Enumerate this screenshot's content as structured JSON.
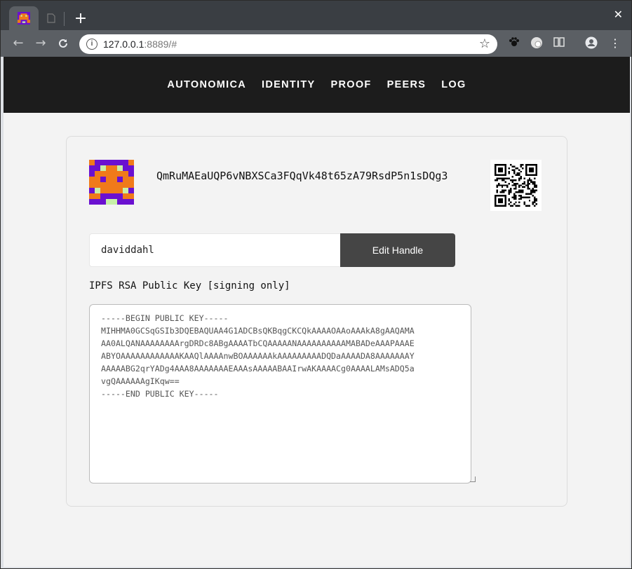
{
  "browser": {
    "url_host": "127.0.0.1",
    "url_rest": ":8889/#"
  },
  "nav": {
    "items": [
      "AUTONOMICA",
      "IDENTITY",
      "PROOF",
      "PEERS",
      "LOG"
    ]
  },
  "identity": {
    "peer_id": "QmRuMAEaUQP6vNBXSCa3FQqVk48t65zA79RsdP5n1sDQg3",
    "handle_value": "daviddahl",
    "edit_handle_label": "Edit Handle",
    "public_key_label": "IPFS RSA Public Key [signing only]",
    "public_key_text": "-----BEGIN PUBLIC KEY-----\nMIHHMA0GCSqGSIb3DQEBAQUAA4G1ADCBsQKBqgCKCQkAAAAOAAoAAAkA8gAAQAMA\nAA0ALQANAAAAAAAArgDRDc8ABgAAAATbCQAAAAANAAAAAAAAAAMABADeAAAPAAAE\nABYOAAAAAAAAAAAAKAAQlAAAAnwBOAAAAAAkAAAAAAAAADQDaAAAADA8AAAAAAAY\nAAAAABG2qrYADg4AAA8AAAAAAAEAAAsAAAAABAAIrwAKAAAACg0AAAALAMsADQ5a\nvgQAAAAAAgIKqw==\n-----END PUBLIC KEY-----"
  },
  "icons": {
    "back": "arrow-left-icon",
    "forward": "arrow-right-icon",
    "reload": "reload-icon",
    "star": "star-icon",
    "close": "close-icon"
  },
  "colors": {
    "nav_bg": "#1c1c1c",
    "button_bg": "#454545",
    "avatar_purple": "#6a10d0",
    "avatar_orange": "#f07a1a",
    "avatar_green": "#c7f0a8"
  }
}
